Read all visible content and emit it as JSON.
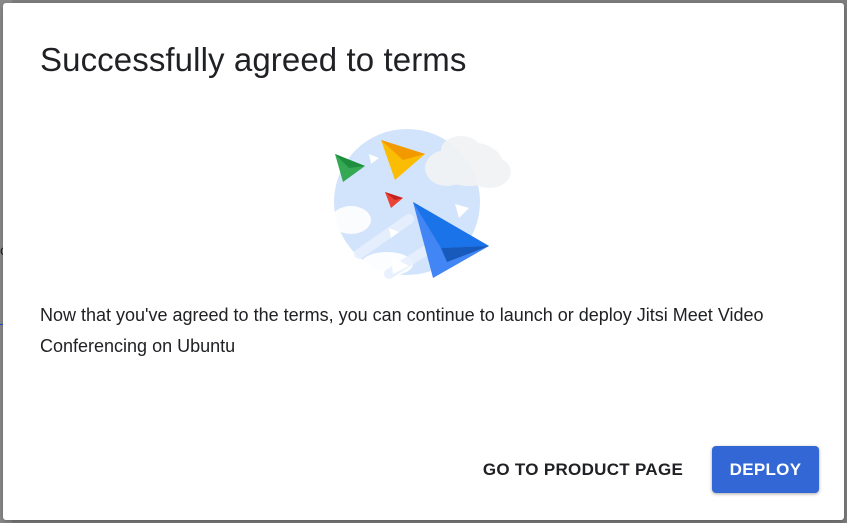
{
  "backdrop": {
    "peek_glyph": "o"
  },
  "dialog": {
    "title": "Successfully agreed to terms",
    "illustration_icon": "paper-planes-illustration",
    "body": "Now that you've agreed to the terms, you can continue to launch or deploy Jitsi Meet Video Conferencing on Ubuntu",
    "actions": {
      "product_page_label": "GO TO PRODUCT PAGE",
      "deploy_label": "DEPLOY"
    }
  },
  "colors": {
    "primary_button": "#3367d6",
    "title_text": "#202124",
    "backdrop": "#7d7d7d"
  }
}
